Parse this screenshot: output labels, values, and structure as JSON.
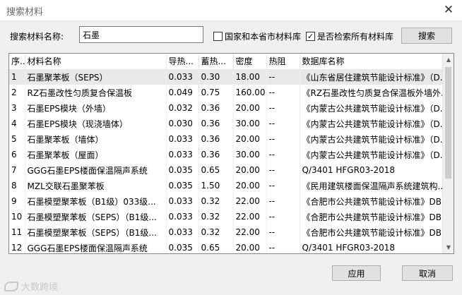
{
  "window": {
    "title": "搜索材料",
    "close_glyph": "✕"
  },
  "search": {
    "label": "搜索材料名称:",
    "value": "石墨",
    "option_province": {
      "label": "国家和本省市材料库",
      "checked": false
    },
    "option_all": {
      "label": "是否检索所有材料库",
      "checked": true
    },
    "button_label": "搜索"
  },
  "table": {
    "columns": [
      "序...",
      "材料名称",
      "导热...",
      "蓄热...",
      "密度",
      "热阻",
      "数据库名称"
    ],
    "rows": [
      [
        "1",
        "石墨聚苯板（SEPS）",
        "0.033",
        "0.30",
        "18.00",
        "--",
        "《山东省居住建筑节能设计标准》（D..."
      ],
      [
        "2",
        "RZ石墨改性匀质复合保温板",
        "0.049",
        "0.75",
        "160.00",
        "--",
        "《RZ石墨改性匀质复合保温板外墙外..."
      ],
      [
        "3",
        "石墨EPS模块（外墙）",
        "0.032",
        "0.36",
        "20.00",
        "--",
        "《内蒙古公共建筑节能设计标准》（D..."
      ],
      [
        "4",
        "石墨EPS模块（现浇墙体）",
        "0.030",
        "0.36",
        "30.00",
        "--",
        "《内蒙古公共建筑节能设计标准》（D..."
      ],
      [
        "5",
        "石墨聚苯板（墙体）",
        "0.033",
        "0.36",
        "20.00",
        "--",
        "《内蒙古公共建筑节能设计标准》（D..."
      ],
      [
        "6",
        "石墨聚苯板（屋面）",
        "0.033",
        "0.36",
        "30.00",
        "--",
        "《内蒙古公共建筑节能设计标准》（D..."
      ],
      [
        "7",
        "GGG石墨EPS楼面保温隔声系统",
        "0.035",
        "0.65",
        "20.00",
        "--",
        "Q/3401 HFGR03-2018"
      ],
      [
        "8",
        "MZL交联石墨聚苯板",
        "0.035",
        "1.50",
        "20.00",
        "--",
        "《民用建筑楼面保温隔声系统建筑构..."
      ],
      [
        "9",
        "石墨模塑聚苯板（B1级）033级...",
        "0.033",
        "0.32",
        "22.00",
        "--",
        "《合肥市公共建筑节能设计标准》DB..."
      ],
      [
        "10",
        "石墨模塑聚苯板（SEPS）（B1级...",
        "0.033",
        "0.32",
        "22.00",
        "--",
        "《合肥市公共建筑节能设计标准》DB..."
      ],
      [
        "11",
        "石墨模塑聚苯板（SEPS）（B1级...",
        "0.033",
        "0.32",
        "22.00",
        "--",
        "《合肥市公共建筑节能设计标准》DB..."
      ],
      [
        "12",
        "GGG石墨EPS楼面保温隔声系统",
        "0.035",
        "0.65",
        "20.00",
        "--",
        "Q/3401 HFGR03-2018"
      ]
    ]
  },
  "buttons": {
    "apply": "应用",
    "cancel": "取消"
  },
  "scrollbar": {
    "up_glyph": "▲",
    "down_glyph": "▼"
  },
  "watermark": {
    "text": "大数跨境"
  }
}
